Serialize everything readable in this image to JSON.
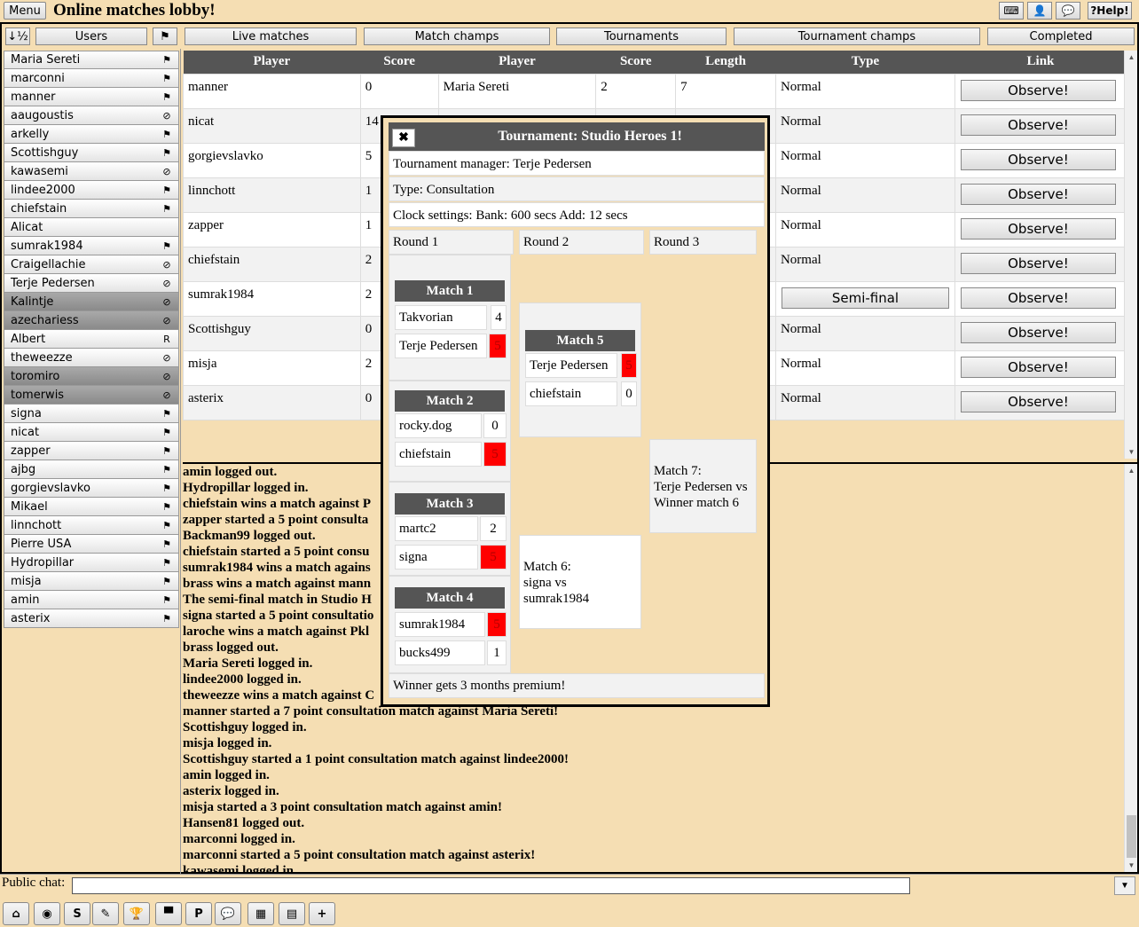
{
  "header": {
    "menu_label": "Menu",
    "title": "Online matches lobby!",
    "help_label": "?Help!"
  },
  "tabs": {
    "sort_label": "↓½",
    "users_label": "Users",
    "live": "Live matches",
    "match_champs": "Match champs",
    "tournaments": "Tournaments",
    "tournament_champs": "Tournament champs",
    "completed": "Completed"
  },
  "users": [
    {
      "name": "Maria Sereti",
      "status": "flag",
      "dark": false
    },
    {
      "name": "marconni",
      "status": "flag",
      "dark": false
    },
    {
      "name": "manner",
      "status": "flag",
      "dark": false
    },
    {
      "name": "aaugoustis",
      "status": "noentry",
      "dark": false
    },
    {
      "name": "arkelly",
      "status": "flag",
      "dark": false
    },
    {
      "name": "Scottishguy",
      "status": "flag",
      "dark": false
    },
    {
      "name": "kawasemi",
      "status": "noentry",
      "dark": false
    },
    {
      "name": "lindee2000",
      "status": "flag",
      "dark": false
    },
    {
      "name": "chiefstain",
      "status": "flag",
      "dark": false
    },
    {
      "name": "Alicat",
      "status": "none",
      "dark": false
    },
    {
      "name": "sumrak1984",
      "status": "flag",
      "dark": false
    },
    {
      "name": "Craigellachie",
      "status": "noentry",
      "dark": false
    },
    {
      "name": "Terje Pedersen",
      "status": "noentry",
      "dark": false
    },
    {
      "name": "Kalintje",
      "status": "noentry",
      "dark": true
    },
    {
      "name": "azechariess",
      "status": "noentry",
      "dark": true
    },
    {
      "name": "Albert",
      "status": "R",
      "dark": false
    },
    {
      "name": "theweezze",
      "status": "noentry",
      "dark": false
    },
    {
      "name": "toromiro",
      "status": "noentry",
      "dark": true
    },
    {
      "name": "tomerwis",
      "status": "noentry",
      "dark": true
    },
    {
      "name": "signa",
      "status": "flag",
      "dark": false
    },
    {
      "name": "nicat",
      "status": "flag",
      "dark": false
    },
    {
      "name": "zapper",
      "status": "flag",
      "dark": false
    },
    {
      "name": "ajbg",
      "status": "flag",
      "dark": false
    },
    {
      "name": "gorgievslavko",
      "status": "flag",
      "dark": false
    },
    {
      "name": "Mikael",
      "status": "flag",
      "dark": false
    },
    {
      "name": "linnchott",
      "status": "flag",
      "dark": false
    },
    {
      "name": "Pierre USA",
      "status": "flag",
      "dark": false
    },
    {
      "name": "Hydropillar",
      "status": "flag",
      "dark": false
    },
    {
      "name": "misja",
      "status": "flag",
      "dark": false
    },
    {
      "name": "amin",
      "status": "flag",
      "dark": false
    },
    {
      "name": "asterix",
      "status": "flag",
      "dark": false
    }
  ],
  "matches_table": {
    "headers": [
      "Player",
      "Score",
      "Player",
      "Score",
      "Length",
      "Type",
      "Link"
    ],
    "observe_label": "Observe!",
    "semi_label": "Semi-final",
    "rows": [
      {
        "p1": "manner",
        "s1": "0",
        "p2": "Maria Sereti",
        "s2": "2",
        "len": "7",
        "type": "Normal"
      },
      {
        "p1": "nicat",
        "s1": "14",
        "p2": "",
        "s2": "",
        "len": "",
        "type": "Normal"
      },
      {
        "p1": "gorgievslavko",
        "s1": "5",
        "p2": "",
        "s2": "",
        "len": "",
        "type": "Normal"
      },
      {
        "p1": "linnchott",
        "s1": "1",
        "p2": "",
        "s2": "",
        "len": "",
        "type": "Normal"
      },
      {
        "p1": "zapper",
        "s1": "1",
        "p2": "",
        "s2": "",
        "len": "",
        "type": "Normal"
      },
      {
        "p1": "chiefstain",
        "s1": "2",
        "p2": "",
        "s2": "",
        "len": "",
        "type": "Normal"
      },
      {
        "p1": "sumrak1984",
        "s1": "2",
        "p2": "",
        "s2": "",
        "len": "",
        "type": "semi"
      },
      {
        "p1": "Scottishguy",
        "s1": "0",
        "p2": "",
        "s2": "",
        "len": "",
        "type": "Normal"
      },
      {
        "p1": "misja",
        "s1": "2",
        "p2": "",
        "s2": "",
        "len": "",
        "type": "Normal"
      },
      {
        "p1": "asterix",
        "s1": "0",
        "p2": "",
        "s2": "",
        "len": "",
        "type": "Normal"
      }
    ]
  },
  "log": [
    "amin logged out.",
    "Hydropillar logged in.",
    "chiefstain wins a match against P",
    "zapper started a 5 point consulta",
    "Backman99 logged out.",
    "chiefstain started a 5 point consu",
    "sumrak1984 wins a match agains",
    "brass wins a match against mann",
    "The semi-final match in Studio H",
    "signa started a 5 point consultatio",
    "laroche wins a match against Pkl",
    "brass logged out.",
    "Maria Sereti logged in.",
    "lindee2000 logged in.",
    "theweezze wins a match against C",
    "manner started a 7 point consultation match against Maria Sereti!",
    "Scottishguy logged in.",
    "misja logged in.",
    "Scottishguy started a 1 point consultation match against lindee2000!",
    "amin logged in.",
    "asterix logged in.",
    "misja started a 3 point consultation match against amin!",
    "Hansen81 logged out.",
    "marconni logged in.",
    "marconni started a 5 point consultation match against asterix!",
    "kawasemi logged in."
  ],
  "chat": {
    "label": "Public chat:",
    "value": ""
  },
  "toolbar": [
    "⌂",
    "◉",
    "S",
    "✎",
    "🏆",
    "▀",
    "P",
    "💬",
    "▦",
    "▤",
    "+"
  ],
  "dialog": {
    "title": "Tournament: Studio Heroes 1!",
    "close": "✖",
    "manager": "Tournament manager: Terje Pedersen",
    "type": "Type: Consultation",
    "clock": "Clock settings: Bank: 600 secs Add: 12 secs",
    "rounds": [
      "Round 1",
      "Round 2",
      "Round 3"
    ],
    "matches": [
      {
        "title": "Match 1",
        "p1": "Takvorian",
        "s1": "4",
        "p2": "Terje Pedersen",
        "s2": "5",
        "winner": 2
      },
      {
        "title": "Match 2",
        "p1": "rocky.dog",
        "s1": "0",
        "p2": "chiefstain",
        "s2": "5",
        "winner": 2
      },
      {
        "title": "Match 3",
        "p1": "martc2",
        "s1": "2",
        "p2": "signa",
        "s2": "5",
        "winner": 2
      },
      {
        "title": "Match 4",
        "p1": "sumrak1984",
        "s1": "5",
        "p2": "bucks499",
        "s2": "1",
        "winner": 1
      },
      {
        "title": "Match 5",
        "p1": "Terje Pedersen",
        "s1": "5",
        "p2": "chiefstain",
        "s2": "0",
        "winner": 1
      }
    ],
    "match6": [
      "Match 6:",
      "signa vs",
      "sumrak1984"
    ],
    "match7": [
      "Match 7:",
      "Terje Pedersen vs",
      "Winner match 6"
    ],
    "prize": "Winner gets 3 months premium!"
  }
}
